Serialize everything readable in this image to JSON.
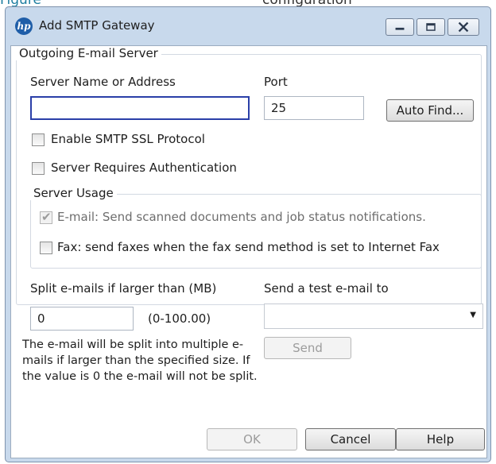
{
  "top_strip": {
    "left_fragment": "Figure",
    "right_fragment": "configuration"
  },
  "window": {
    "title": "Add SMTP Gateway",
    "app_icon": "hp-logo-icon",
    "controls": {
      "minimize": "minimize-icon",
      "maximize": "maximize-icon",
      "close": "close-icon"
    }
  },
  "outgoing": {
    "legend": "Outgoing E-mail Server",
    "server_label": "Server Name or Address",
    "server_value": "",
    "port_label": "Port",
    "port_value": "25",
    "auto_find_label": "Auto Find...",
    "ssl_label": "Enable SMTP SSL Protocol",
    "ssl_checked": false,
    "auth_label": "Server Requires Authentication",
    "auth_checked": false
  },
  "usage": {
    "legend": "Server Usage",
    "email_label": "E-mail:  Send scanned documents and job status notifications.",
    "email_checked": true,
    "email_disabled": true,
    "fax_label": "Fax: send faxes when the fax send method is set to Internet Fax",
    "fax_checked": false
  },
  "split": {
    "label": "Split e-mails if larger than (MB)",
    "value": "0",
    "range": "(0-100.00)",
    "note": "The e-mail will be split into multiple e-mails if larger than the specified size. If the value is 0 the e-mail will not be split."
  },
  "test_email": {
    "label": "Send a test e-mail to",
    "selected": "",
    "send_label": "Send"
  },
  "footer": {
    "ok_label": "OK",
    "cancel_label": "Cancel",
    "help_label": "Help"
  }
}
